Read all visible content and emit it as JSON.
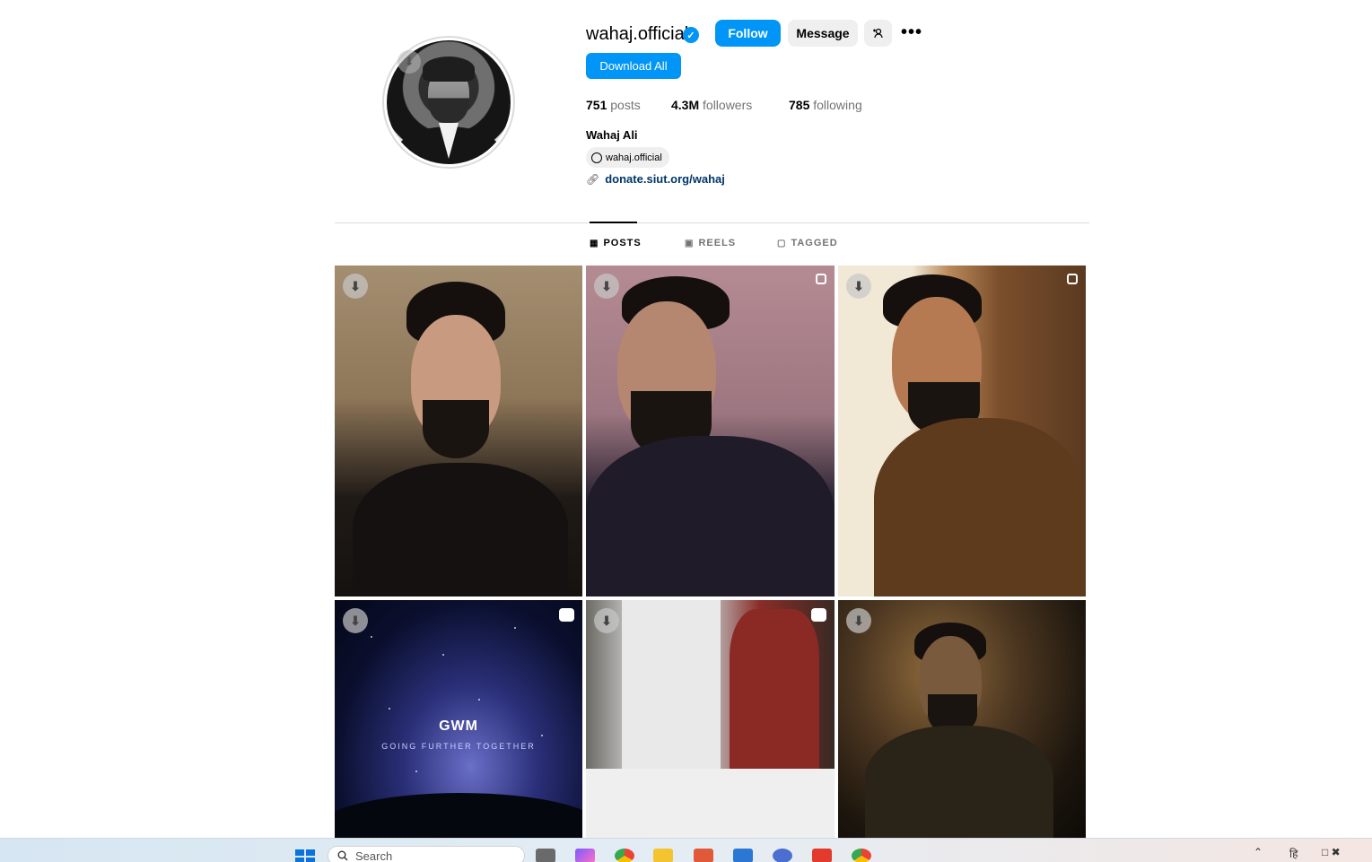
{
  "profile": {
    "username": "wahaj.official",
    "follow_label": "Follow",
    "message_label": "Message",
    "download_all_label": "Download All",
    "stats": {
      "posts_count": "751",
      "posts_label": "posts",
      "followers_count": "4.3M",
      "followers_label": "followers",
      "following_count": "785",
      "following_label": "following"
    },
    "full_name": "Wahaj Ali",
    "threads_handle": "wahaj.official",
    "link": "donate.siut.org/wahaj"
  },
  "tabs": [
    {
      "label": "POSTS",
      "active": true
    },
    {
      "label": "REELS",
      "active": false
    },
    {
      "label": "TAGGED",
      "active": false
    }
  ],
  "posts": [
    {
      "type": "photo",
      "description": ""
    },
    {
      "type": "carousel"
    },
    {
      "type": "carousel"
    },
    {
      "type": "reel",
      "overlay_brand": "GWM",
      "overlay_tagline": "GOING FURTHER TOGETHER"
    },
    {
      "type": "reel"
    },
    {
      "type": "photo"
    }
  ],
  "taskbar": {
    "search_placeholder": "Search",
    "tray_lang": "हि"
  },
  "colors": {
    "primary_button": "#0095f6",
    "secondary_button": "#efefef",
    "link": "#00376b",
    "muted_text": "#737373",
    "divider": "#dbdbdb"
  },
  "icons": [
    "verified-badge-icon",
    "add-user-icon",
    "more-options-icon",
    "threads-icon",
    "link-icon",
    "grid-icon",
    "reels-icon",
    "tagged-icon",
    "download-icon",
    "carousel-icon",
    "reel-icon",
    "windows-start-icon",
    "search-icon"
  ]
}
